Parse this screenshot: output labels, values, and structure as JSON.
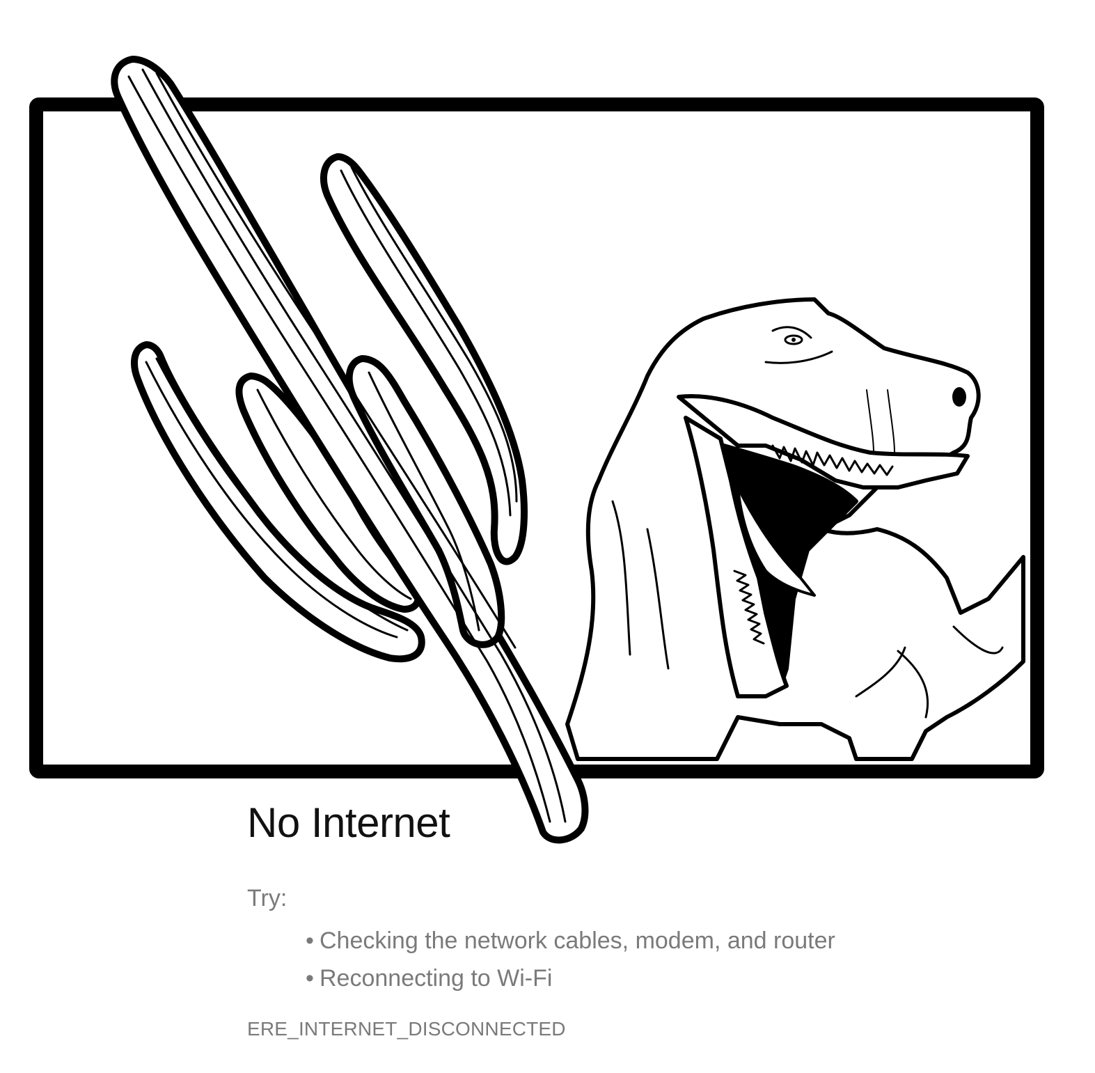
{
  "error_page": {
    "title": "No Internet",
    "try_label": "Try:",
    "suggestions": [
      "Checking the network cables, modem, and router",
      "Reconnecting to Wi-Fi"
    ],
    "bullet": "•",
    "error_code": "ERE_INTERNET_DISCONNECTED"
  },
  "illustration": {
    "subject": "t-rex-and-cactus-line-art",
    "stroke_color": "#000000",
    "fill_color": "#ffffff"
  },
  "colors": {
    "title": "#111111",
    "body_text": "#7a7a7a",
    "background": "#ffffff"
  }
}
